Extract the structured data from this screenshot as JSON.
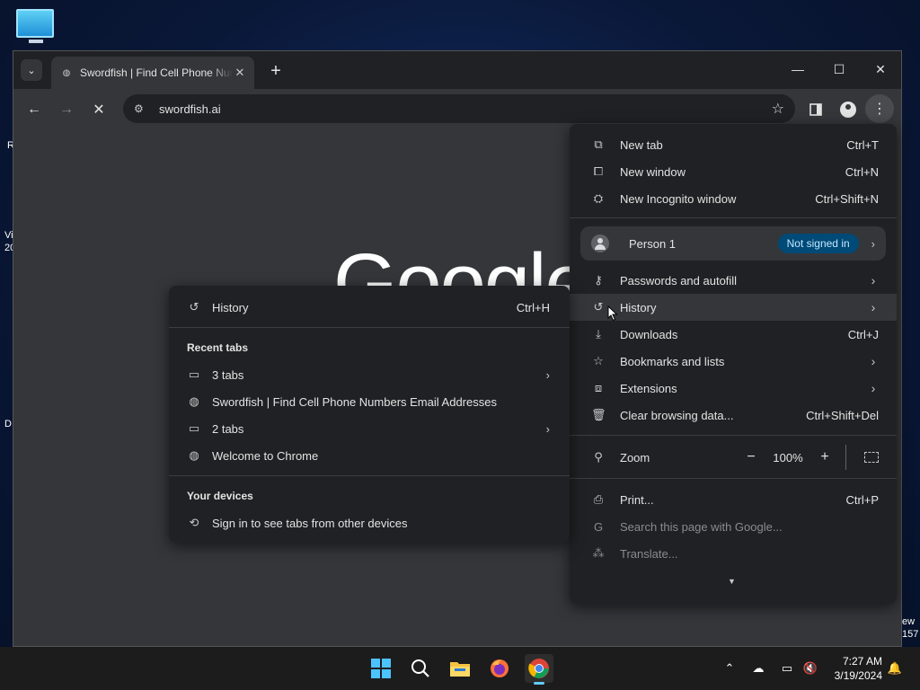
{
  "desktop": {
    "edge_texts": [
      "R",
      "Vi",
      "20",
      "D",
      "ew",
      "157"
    ]
  },
  "browser": {
    "tab_title": "Swordfish | Find Cell Phone Numbers  Email Addresses",
    "url": "swordfish.ai",
    "page_logo": "Google"
  },
  "menu": {
    "new_tab": {
      "label": "New tab",
      "shortcut": "Ctrl+T"
    },
    "new_window": {
      "label": "New window",
      "shortcut": "Ctrl+N"
    },
    "new_incognito": {
      "label": "New Incognito window",
      "shortcut": "Ctrl+Shift+N"
    },
    "person": {
      "name": "Person 1",
      "status": "Not signed in"
    },
    "passwords": {
      "label": "Passwords and autofill"
    },
    "history": {
      "label": "History"
    },
    "downloads": {
      "label": "Downloads",
      "shortcut": "Ctrl+J"
    },
    "bookmarks": {
      "label": "Bookmarks and lists"
    },
    "extensions": {
      "label": "Extensions"
    },
    "clear_data": {
      "label": "Clear browsing data...",
      "shortcut": "Ctrl+Shift+Del"
    },
    "zoom": {
      "label": "Zoom",
      "value": "100%",
      "minus": "−",
      "plus": "+"
    },
    "print": {
      "label": "Print...",
      "shortcut": "Ctrl+P"
    },
    "search_page": {
      "label": "Search this page with Google..."
    },
    "translate": {
      "label": "Translate..."
    }
  },
  "history_submenu": {
    "history": {
      "label": "History",
      "shortcut": "Ctrl+H"
    },
    "recent_tabs_heading": "Recent tabs",
    "items": [
      {
        "label": "3 tabs",
        "icon": "window-icon",
        "has_submenu": true
      },
      {
        "label": "Swordfish | Find Cell Phone Numbers  Email Addresses",
        "icon": "globe-icon",
        "has_submenu": false
      },
      {
        "label": "2 tabs",
        "icon": "window-icon",
        "has_submenu": true
      },
      {
        "label": "Welcome to Chrome",
        "icon": "globe-icon",
        "has_submenu": false
      }
    ],
    "devices_heading": "Your devices",
    "sign_in_text": "Sign in to see tabs from other devices"
  },
  "taskbar": {
    "time": "7:27 AM",
    "date": "3/19/2024"
  },
  "colors": {
    "accent": "#4cc2ff",
    "pill_bg": "#004a77",
    "pill_text": "#c2e7ff",
    "menu_bg": "#202124"
  }
}
